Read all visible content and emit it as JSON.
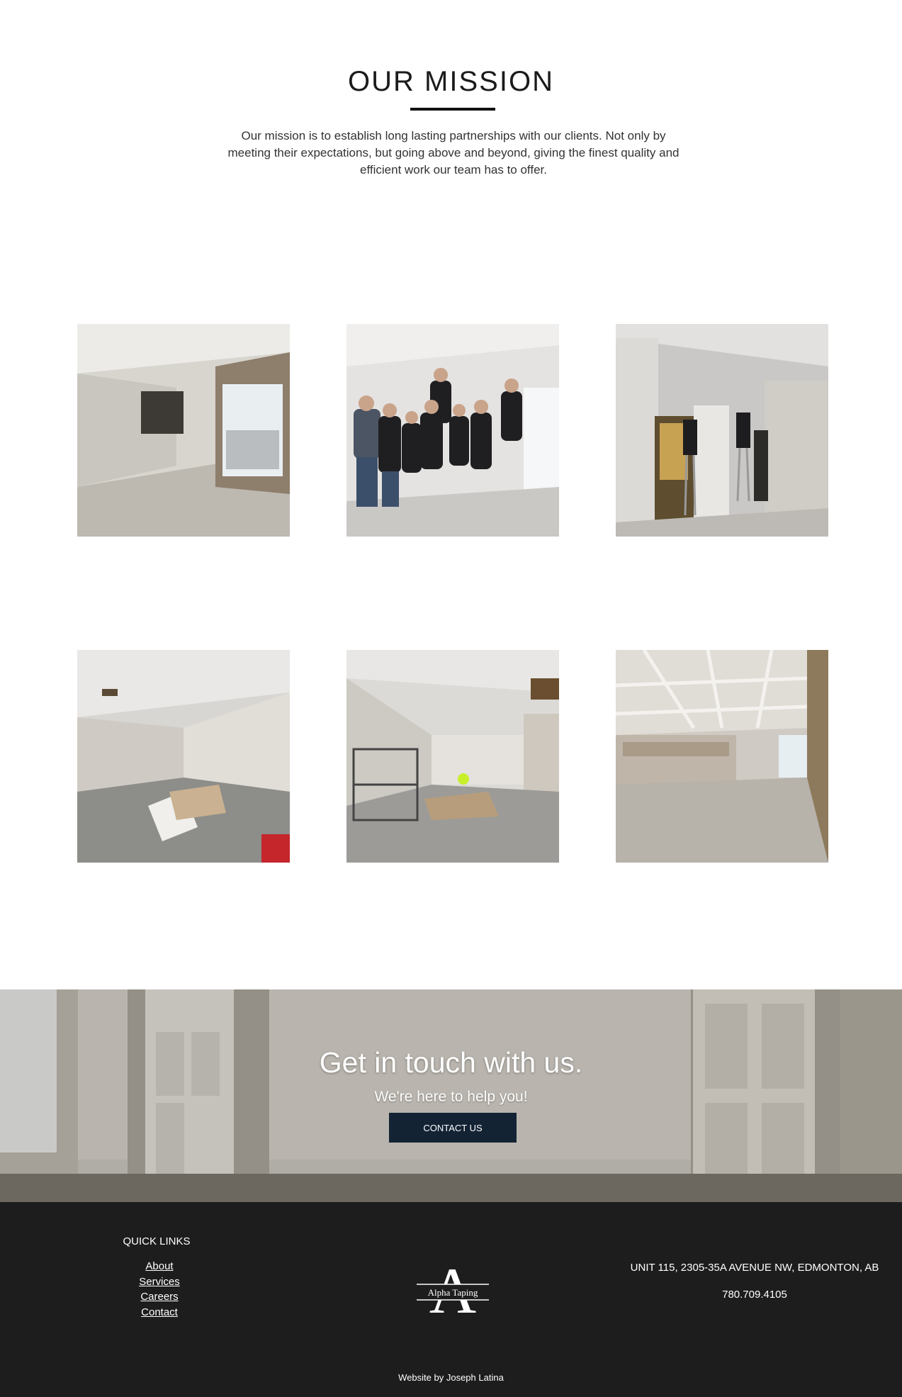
{
  "mission": {
    "title": "OUR MISSION",
    "text": "Our mission is to establish long lasting partnerships with our clients. Not only by meeting their expectations, but going above and beyond, giving the finest quality and efficient work our team has to offer."
  },
  "gallery": [
    {
      "subject": "empty drywalled room with doorway"
    },
    {
      "subject": "crew group photo on stilts"
    },
    {
      "subject": "workers on stilts taping walls"
    },
    {
      "subject": "open room with debris pile"
    },
    {
      "subject": "room with scaffolding and wood pile"
    },
    {
      "subject": "finished ceiling room with cabinets"
    }
  ],
  "cta": {
    "title": "Get in touch with us.",
    "subtitle": "We're here to help you!",
    "button_label": "CONTACT US"
  },
  "footer": {
    "quick_links_title": "QUICK LINKS",
    "links": [
      "About",
      "Services",
      "Careers",
      "Contact"
    ],
    "logo_text": "Alpha Taping",
    "logo_letter": "A",
    "address": "UNIT 115, 2305-35A AVENUE NW, EDMONTON, AB",
    "phone": "780.709.4105",
    "credit": "Website by Joseph Latina"
  },
  "colors": {
    "button_bg": "#132334",
    "footer_bg": "#1d1d1d"
  }
}
